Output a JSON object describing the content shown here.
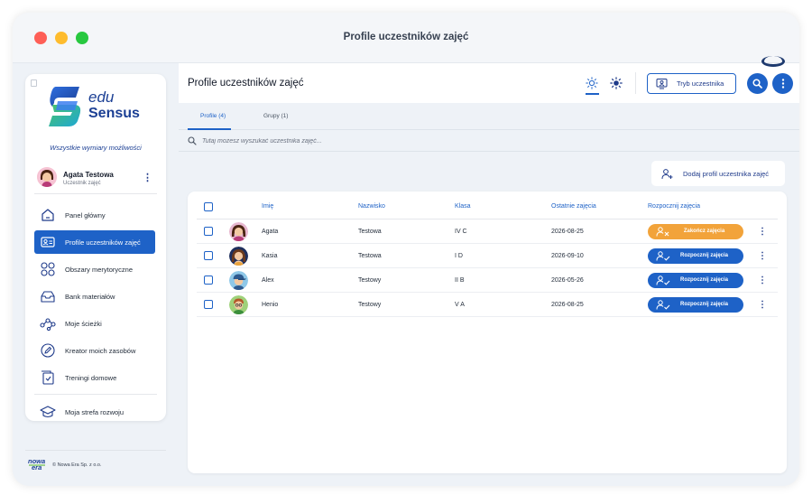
{
  "window": {
    "title": "Profile uczestników zajęć"
  },
  "brand": {
    "word1": "edu",
    "word2": "Sensus",
    "tagline": "Wszystkie wymiary możliwości"
  },
  "user": {
    "name": "Agata Testowa",
    "role": "Uczestnik zajęć"
  },
  "sidebar": {
    "items": [
      {
        "label": "Panel główny",
        "icon": "home-icon",
        "active": false
      },
      {
        "label": "Profile uczestników zajęć",
        "icon": "id-card-icon",
        "active": true
      },
      {
        "label": "Obszary merytoryczne",
        "icon": "grid-circles-icon",
        "active": false
      },
      {
        "label": "Bank materiałów",
        "icon": "inbox-stack-icon",
        "active": false
      },
      {
        "label": "Moje ścieżki",
        "icon": "path-nodes-icon",
        "active": false
      },
      {
        "label": "Kreator moich zasobów",
        "icon": "pencil-circle-icon",
        "active": false
      },
      {
        "label": "Treningi domowe",
        "icon": "clipboard-check-icon",
        "active": false
      },
      {
        "label": "Moja strefa rozwoju",
        "icon": "graduation-cap-icon",
        "active": false
      }
    ]
  },
  "footer": {
    "logo_top": "nowa",
    "logo_bottom": "era",
    "copyright": "© Nowa Era Sp. z o.o."
  },
  "header": {
    "title": "Profile uczestników zajęć",
    "mode_button": "Tryb uczestnika"
  },
  "tabs": [
    {
      "label": "Profile (4)",
      "active": true
    },
    {
      "label": "Grupy (1)",
      "active": false
    }
  ],
  "search": {
    "placeholder": "Tutaj możesz wyszukać uczestnika zajęć..."
  },
  "add_profile": {
    "label": "Dodaj profil uczestnika zajęć"
  },
  "table": {
    "columns": [
      "Imię",
      "Nazwisko",
      "Klasa",
      "Ostatnie zajęcia",
      "Rozpocznij zajęcia"
    ],
    "rows": [
      {
        "first": "Agata",
        "last": "Testowa",
        "class": "IV C",
        "last_session": "2026-08-25",
        "action": "Zakończ zajęcia",
        "action_type": "end",
        "avatar": "girl-pink"
      },
      {
        "first": "Kasia",
        "last": "Testowa",
        "class": "I D",
        "last_session": "2026-09-10",
        "action": "Rozpocznij zajęcia",
        "action_type": "start",
        "avatar": "girl-navy"
      },
      {
        "first": "Alex",
        "last": "Testowy",
        "class": "II B",
        "last_session": "2026-05-26",
        "action": "Rozpocznij zajęcia",
        "action_type": "start",
        "avatar": "boy-cap"
      },
      {
        "first": "Henio",
        "last": "Testowy",
        "class": "V A",
        "last_session": "2026-08-25",
        "action": "Rozpocznij zajęcia",
        "action_type": "start",
        "avatar": "boy-glasses"
      }
    ]
  },
  "colors": {
    "primary": "#1e62c7",
    "navy": "#1b3f94",
    "accent_orange": "#f2a33a",
    "background": "#eef2f7"
  }
}
